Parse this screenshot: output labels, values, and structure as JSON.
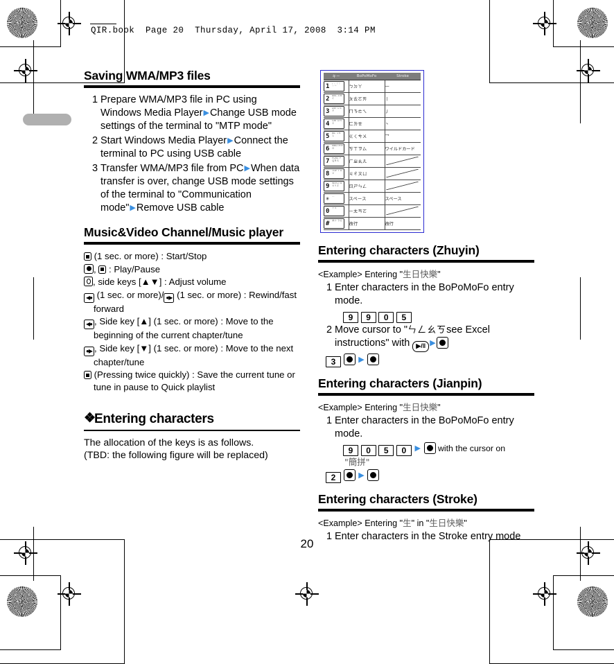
{
  "print_header": {
    "text": "QIR.book  Page 20  Thursday, April 17, 2008  3:14 PM"
  },
  "page_number": "20",
  "left_column": {
    "section_saving": {
      "heading": "Saving WMA/MP3 files",
      "steps": [
        {
          "num": "1",
          "parts": [
            {
              "t": "text",
              "v": "Prepare WMA/MP3 file in PC using Windows Media Player "
            },
            {
              "t": "arrow"
            },
            {
              "t": "text",
              "v": " Change USB mode settings of the terminal to \"MTP mode\""
            }
          ]
        },
        {
          "num": "2",
          "parts": [
            {
              "t": "text",
              "v": "Start Windows Media Player "
            },
            {
              "t": "arrow"
            },
            {
              "t": "text",
              "v": " Connect the terminal to PC using USB cable"
            }
          ]
        },
        {
          "num": "3",
          "parts": [
            {
              "t": "text",
              "v": "Transfer WMA/MP3 file from PC "
            },
            {
              "t": "arrow"
            },
            {
              "t": "text",
              "v": " When data transfer is over, change USB mode settings of the terminal to \"Communication mode\" "
            },
            {
              "t": "arrow"
            },
            {
              "t": "text",
              "v": " Remove USB cable"
            }
          ]
        }
      ]
    },
    "section_music": {
      "heading": "Music&Video Channel/Music player",
      "key_functions": [
        " (1 sec. or more) : Start/Stop",
        ", ",
        " : Play/Pause",
        ", side keys [▲▼] : Adjust volume",
        " (1 sec. or more)/",
        " (1 sec. or more) : Rewind/fast forward",
        ", Side key [▲] (1 sec. or more) : Move to the beginning of the current chapter/tune",
        ", Side key [▼] (1 sec. or more) : Move to the next chapter/tune",
        " (Pressing twice quickly) : Save the current tune or tune in pause to Quick playlist"
      ]
    },
    "section_entering": {
      "heading": "Entering characters",
      "bullet": "❖",
      "body_line_1": "The allocation of the keys is as follows.",
      "body_line_2": "(TBD: the following figure will be replaced)"
    }
  },
  "right_column": {
    "keypad_figure": {
      "headers": [
        "キー",
        "BoPoMoFo",
        "Stroke"
      ],
      "rows": [
        {
          "key": "1",
          "key_sub": "。、？！\n・－",
          "bopomofo": "ㄅㄉㄚ",
          "stroke": "一"
        },
        {
          "key": "2",
          "key_sub": "ABC\nＡＢＣ",
          "bopomofo": "ㄆㄊㄛㄞ",
          "stroke": "丨"
        },
        {
          "key": "3",
          "key_sub": "DEF\nＤＥＦ",
          "bopomofo": "ㄇㄋㄜㄟ",
          "stroke": "丿"
        },
        {
          "key": "4",
          "key_sub": "GHI\nＧＨＩ",
          "bopomofo": "ㄈㄌㄝ",
          "stroke": "丶"
        },
        {
          "key": "5",
          "key_sub": "JKL\nＪＫＬ",
          "bopomofo": "ㄍㄑㄘㄨ",
          "stroke": "乛"
        },
        {
          "key": "6",
          "key_sub": "MNO\nＭＮＯ",
          "bopomofo": "ㄎㄒㄗㄙ",
          "stroke": "ワイルドカード"
        },
        {
          "key": "7",
          "key_sub": "PQRS\nＰＱＲＳ",
          "bopomofo": "ㄏㄓㄠㄦ",
          "stroke": ""
        },
        {
          "key": "8",
          "key_sub": "TUV\nＴＵＶ",
          "bopomofo": "ㄐㄔㄡㄩ",
          "stroke": ""
        },
        {
          "key": "9",
          "key_sub": "WXYZ\nＷＸＹＺ",
          "bopomofo": "ㄖㄕㄣㄥ",
          "stroke": ""
        },
        {
          "key": "✳",
          "key_sub": "＿",
          "bopomofo": "スペース",
          "stroke": "スペース"
        },
        {
          "key": "0",
          "key_sub": "＋＊",
          "bopomofo": "ㄧㄤㄢㄛ",
          "stroke": ""
        },
        {
          "key": "#",
          "key_sub": "ぁぃ\nぅぇ",
          "bopomofo": "改行",
          "stroke": "改行"
        }
      ]
    },
    "section_zhuyin": {
      "heading": "Entering characters (Zhuyin)",
      "example_label": "<Example>",
      "example_text_pre": "Entering \"",
      "example_cjk": "生日快樂",
      "example_text_post": "\"",
      "step1_num": "1",
      "step1_text": "Enter characters in the BoPoMoFo entry mode.",
      "step1_keys": [
        "9",
        "9",
        "0",
        "5"
      ],
      "step2_num": "2",
      "step2_text_pre": "Move cursor to \"",
      "step2_bopomofo": "ㄣㄥㄠㄎ",
      "step2_text_post": "see Excel instructions\" with ",
      "step2_playpause": "▶/‖",
      "step3_keys": [
        "3"
      ]
    },
    "section_jianpin": {
      "heading": "Entering characters (Jianpin)",
      "example_label": "<Example>",
      "example_text_pre": "Entering \"",
      "example_cjk": "生日快樂",
      "example_text_post": "\"",
      "step1_num": "1",
      "step1_text": "Enter characters in the BoPoMoFo entry mode.",
      "step1_keys": [
        "9",
        "0",
        "5",
        "0"
      ],
      "step1_note": " with the cursor on",
      "step1_note_cjk": "\"簡拼\"",
      "step2_keys": [
        "2"
      ]
    },
    "section_stroke": {
      "heading": "Entering characters (Stroke)",
      "example_label": "<Example>",
      "example_text_pre": "Entering \"",
      "example_cjk_1": "生",
      "example_text_mid": "\" in \"",
      "example_cjk_2": "生日快樂",
      "example_text_post": "\"",
      "step1_num": "1",
      "step1_text": "Enter characters in the Stroke entry mode"
    }
  },
  "colors": {
    "arrow_blue": "#3a8fe0",
    "figure_border_blue": "#2a2ad0",
    "tab_gray": "#b0b0b0"
  }
}
